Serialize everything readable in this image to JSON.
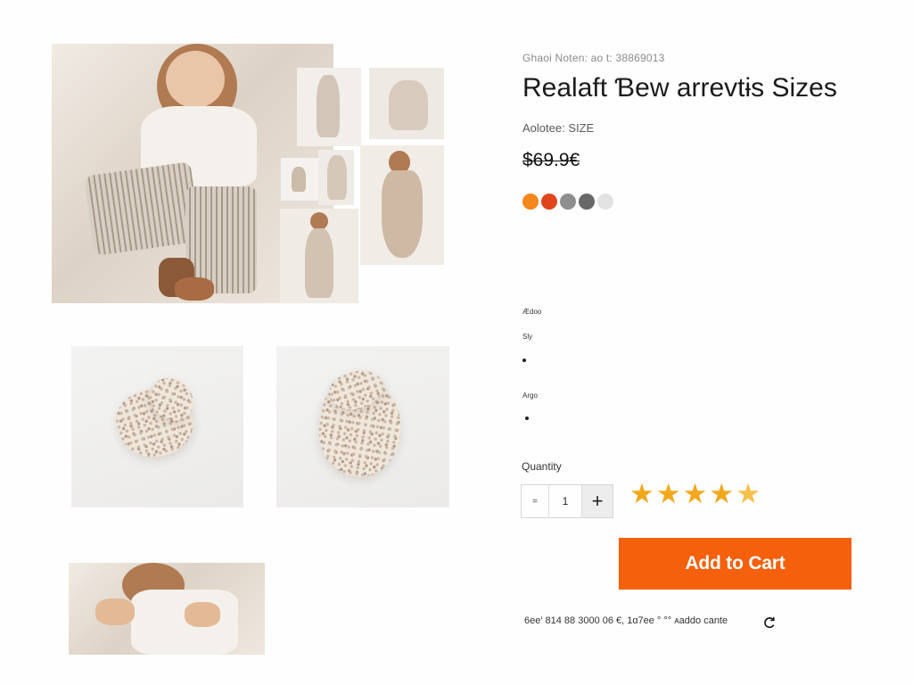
{
  "product": {
    "brand_line": "Ghaoi Noten: ao t: 38869013",
    "title": "Realaft Ɓew arrevtɨs Sizes",
    "size_line": "Aolotee: SIZE",
    "price": "$69.9€",
    "colors": [
      {
        "name": "orange",
        "hex": "#f4861a"
      },
      {
        "name": "red-orange",
        "hex": "#e0461a"
      },
      {
        "name": "gray",
        "hex": "#8e8e8e"
      },
      {
        "name": "dark-gray",
        "hex": "#686868"
      },
      {
        "name": "light-gray",
        "hex": "#e2e2e2"
      }
    ]
  },
  "options": {
    "label1": "Ædoo",
    "label2": "Sly",
    "label3": "Argo"
  },
  "quantity": {
    "label": "Quantity",
    "minus": "=",
    "value": "1",
    "plus": "+"
  },
  "rating": {
    "value": 4.5,
    "max": 5,
    "full_star": "★"
  },
  "cart": {
    "button_label": "Add to Cart",
    "accent_color": "#f4600c"
  },
  "footer": {
    "text": "6ee' 814 88 3000 06 €, 1ɑ7ee ° °° ᴀaddo cante"
  },
  "icons": {
    "refresh": "refresh-icon"
  }
}
